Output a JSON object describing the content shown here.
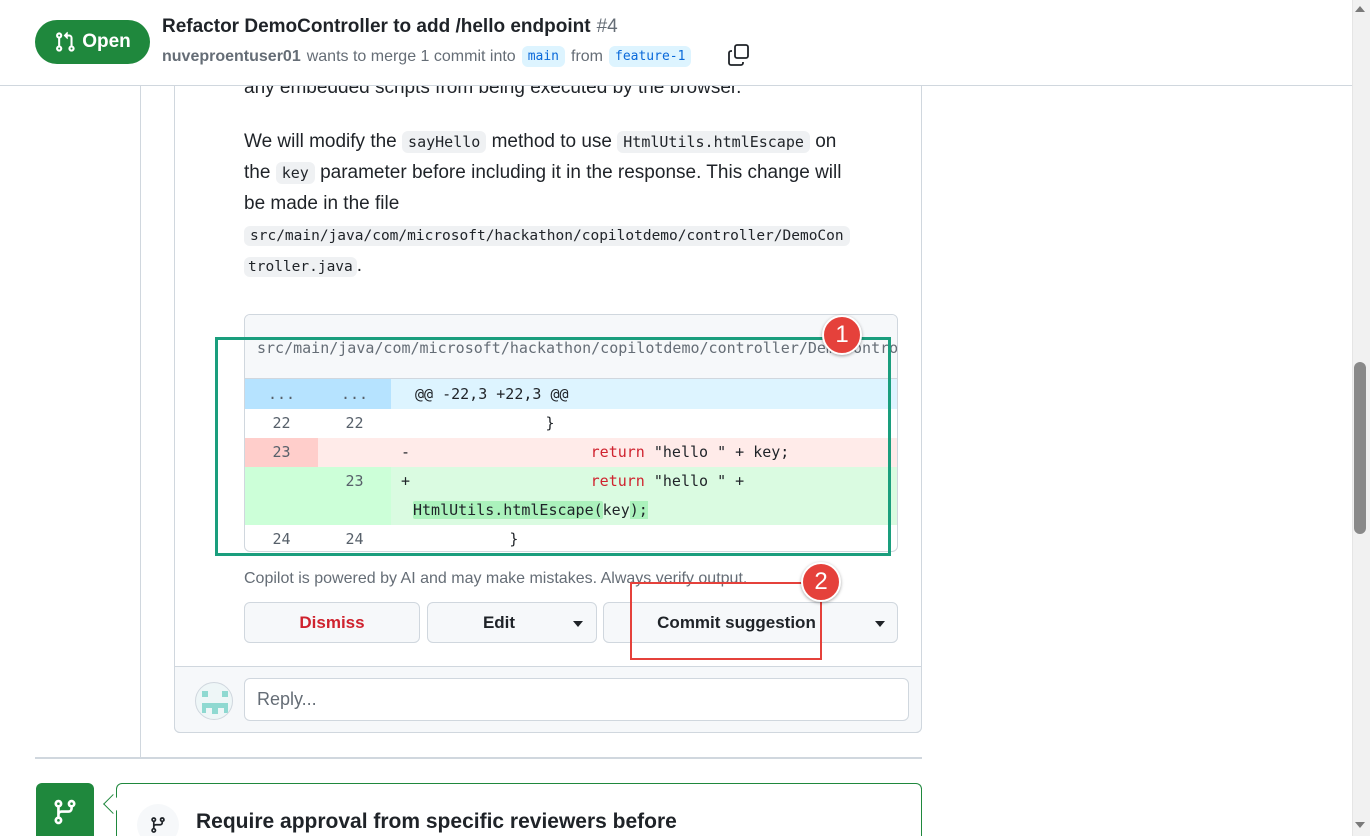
{
  "header": {
    "state": "Open",
    "title": "Refactor DemoController to add /hello endpoint",
    "number": "#4",
    "author": "nuveproentuser01",
    "merge_text": "wants to merge 1 commit into",
    "base_branch": "main",
    "from_text": "from",
    "head_branch": "feature-1",
    "copy_icon": "copy-icon"
  },
  "comment": {
    "line0": "any embedded scripts from being executed by the browser.",
    "p1_a": "We will modify the",
    "p1_code1": "sayHello",
    "p1_b": "method to use",
    "p1_code2": "HtmlUtils.htmlEscape",
    "p1_c": "on",
    "p2_a": "the",
    "p2_code": "key",
    "p2_b": "parameter before including it in the response. This change will",
    "p3": "be made in the file",
    "file_path_1": "src/main/java/com/microsoft/hackathon/copilotdemo/controller/DemoCon",
    "file_path_2": "troller.java",
    "period": "."
  },
  "suggestion": {
    "file_path": "src/main/java/com/microsoft/hackathon/copilotdemo/controller/DemoController.java",
    "hunk_left": "...",
    "hunk_right": "...",
    "hunk_header": "@@ -22,3 +22,3 @@",
    "rows": [
      {
        "old": "22",
        "new": "22",
        "sign": " ",
        "code": "                }"
      },
      {
        "old": "23",
        "new": "",
        "sign": "-",
        "kw": "return",
        "code": " \"hello \" + key;"
      },
      {
        "old": "",
        "new": "23",
        "sign": "+",
        "kw": "return",
        "code": " \"hello \" +"
      },
      {
        "code_wrap": "HtmlUtils.htmlEscape(",
        "code_wrap_end": "key",
        "code_wrap_tail": ");"
      },
      {
        "old": "24",
        "new": "24",
        "sign": " ",
        "code": "            }"
      }
    ]
  },
  "disclaimer": "Copilot is powered by AI and may make mistakes. Always verify output.",
  "actions": {
    "dismiss": "Dismiss",
    "edit": "Edit",
    "commit": "Commit suggestion"
  },
  "annotations": {
    "marker1": "1",
    "marker2": "2"
  },
  "reply": {
    "placeholder": "Reply..."
  },
  "merge_box": {
    "title": "Require approval from specific reviewers before"
  },
  "colors": {
    "open_green": "#1f883d",
    "annotation_teal": "#1a9e7d",
    "annotation_red": "#e5413b",
    "deletion_bg": "#ffebe9",
    "addition_bg": "#dafbe1",
    "hunk_bg": "#ddf4ff"
  }
}
